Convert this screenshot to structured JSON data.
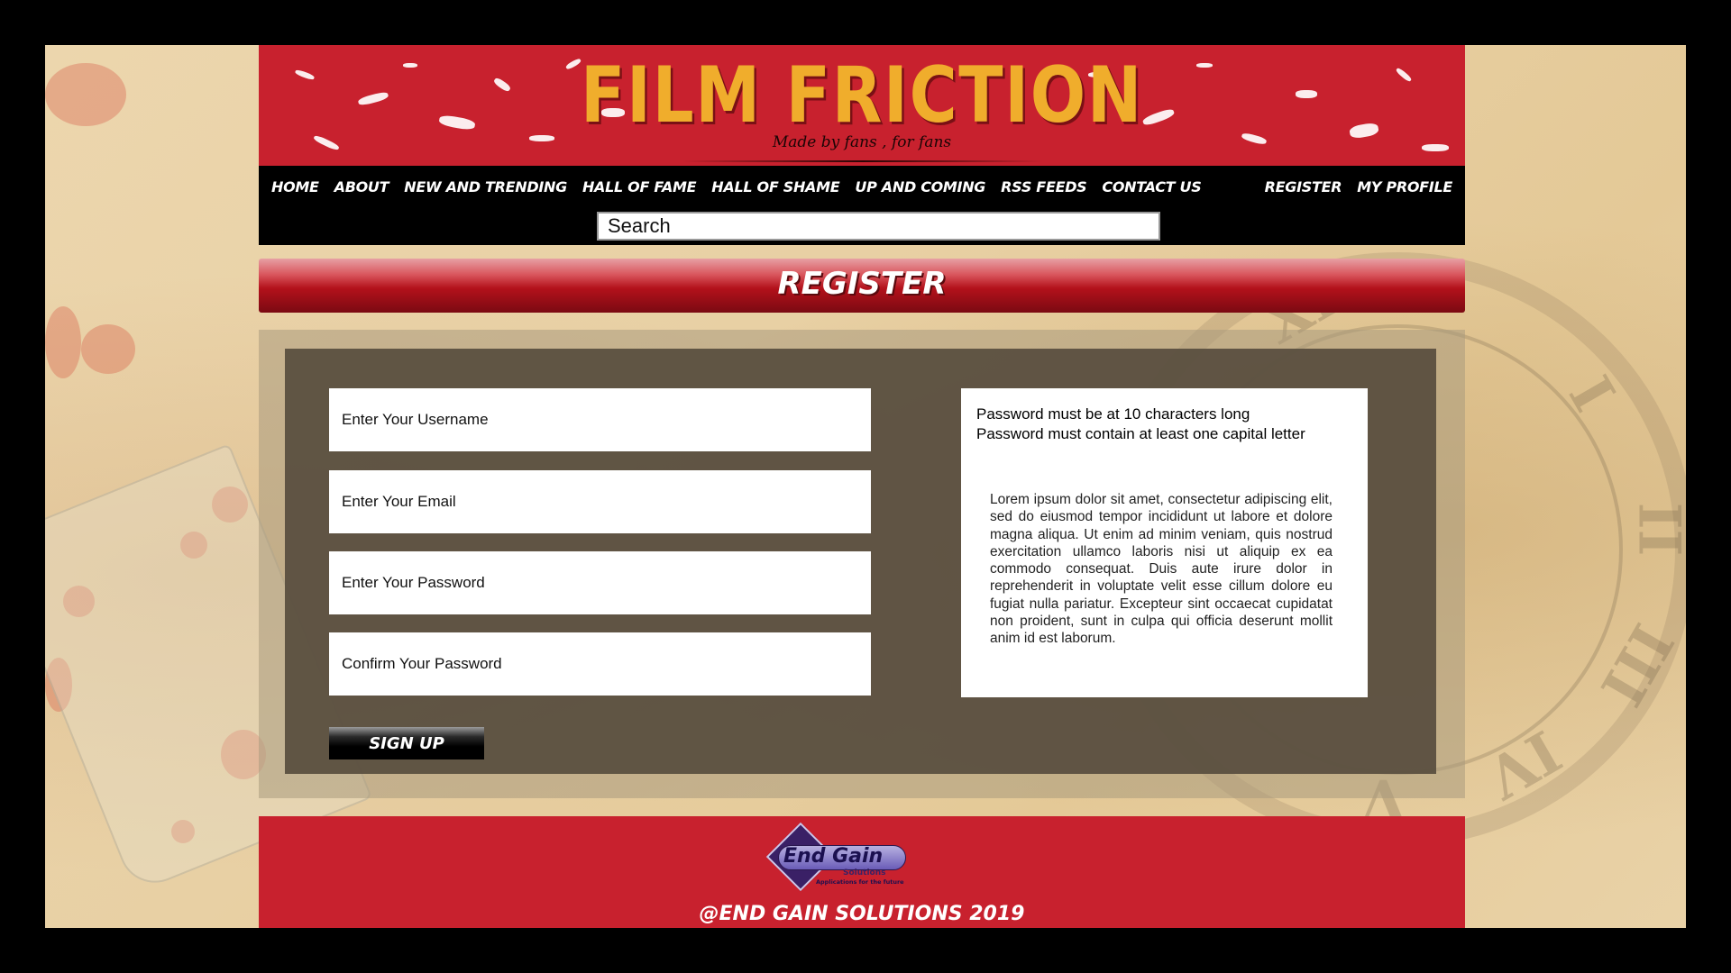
{
  "header": {
    "title": "FILM FRICTION",
    "tagline": "Made by fans , for fans"
  },
  "nav": {
    "left_items": [
      {
        "label": "HOME"
      },
      {
        "label": "ABOUT"
      },
      {
        "label": "NEW AND TRENDING"
      },
      {
        "label": "HALL OF FAME"
      },
      {
        "label": "HALL OF SHAME"
      },
      {
        "label": "UP AND COMING"
      },
      {
        "label": "RSS FEEDS"
      },
      {
        "label": "CONTACT US"
      }
    ],
    "right_items": [
      {
        "label": "REGISTER"
      },
      {
        "label": "MY PROFILE"
      }
    ],
    "search_placeholder": "Search"
  },
  "page": {
    "title": "REGISTER"
  },
  "form": {
    "username_placeholder": "Enter Your Username",
    "email_placeholder": "Enter Your Email",
    "password_placeholder": "Enter Your Password",
    "confirm_placeholder": "Confirm Your Password",
    "signup_label": "SIGN UP"
  },
  "info": {
    "rule_1": "Password must be at 10 characters long",
    "rule_2": "Password must contain at least one capital letter",
    "lorem": "Lorem ipsum dolor sit amet, consectetur adipiscing elit, sed do eiusmod tempor incididunt ut labore et dolore magna aliqua. Ut enim ad minim veniam, quis nostrud exercitation ullamco laboris nisi ut aliquip ex ea commodo consequat. Duis aute irure dolor in reprehenderit in voluptate velit esse cillum dolore eu fugiat nulla pariatur. Excepteur sint occaecat cupidatat non proident, sunt in culpa qui officia deserunt mollit anim id est laborum."
  },
  "footer": {
    "logo_name": "End Gain",
    "logo_sub": "Solutions",
    "logo_tagline": "Applications for the future",
    "copyright": "@END GAIN SOLUTIONS 2019"
  },
  "colors": {
    "brand_red": "#c8212e",
    "title_gold": "#f0ad2c",
    "nav_bg": "#000000",
    "panel_bg": "#584e3e"
  }
}
